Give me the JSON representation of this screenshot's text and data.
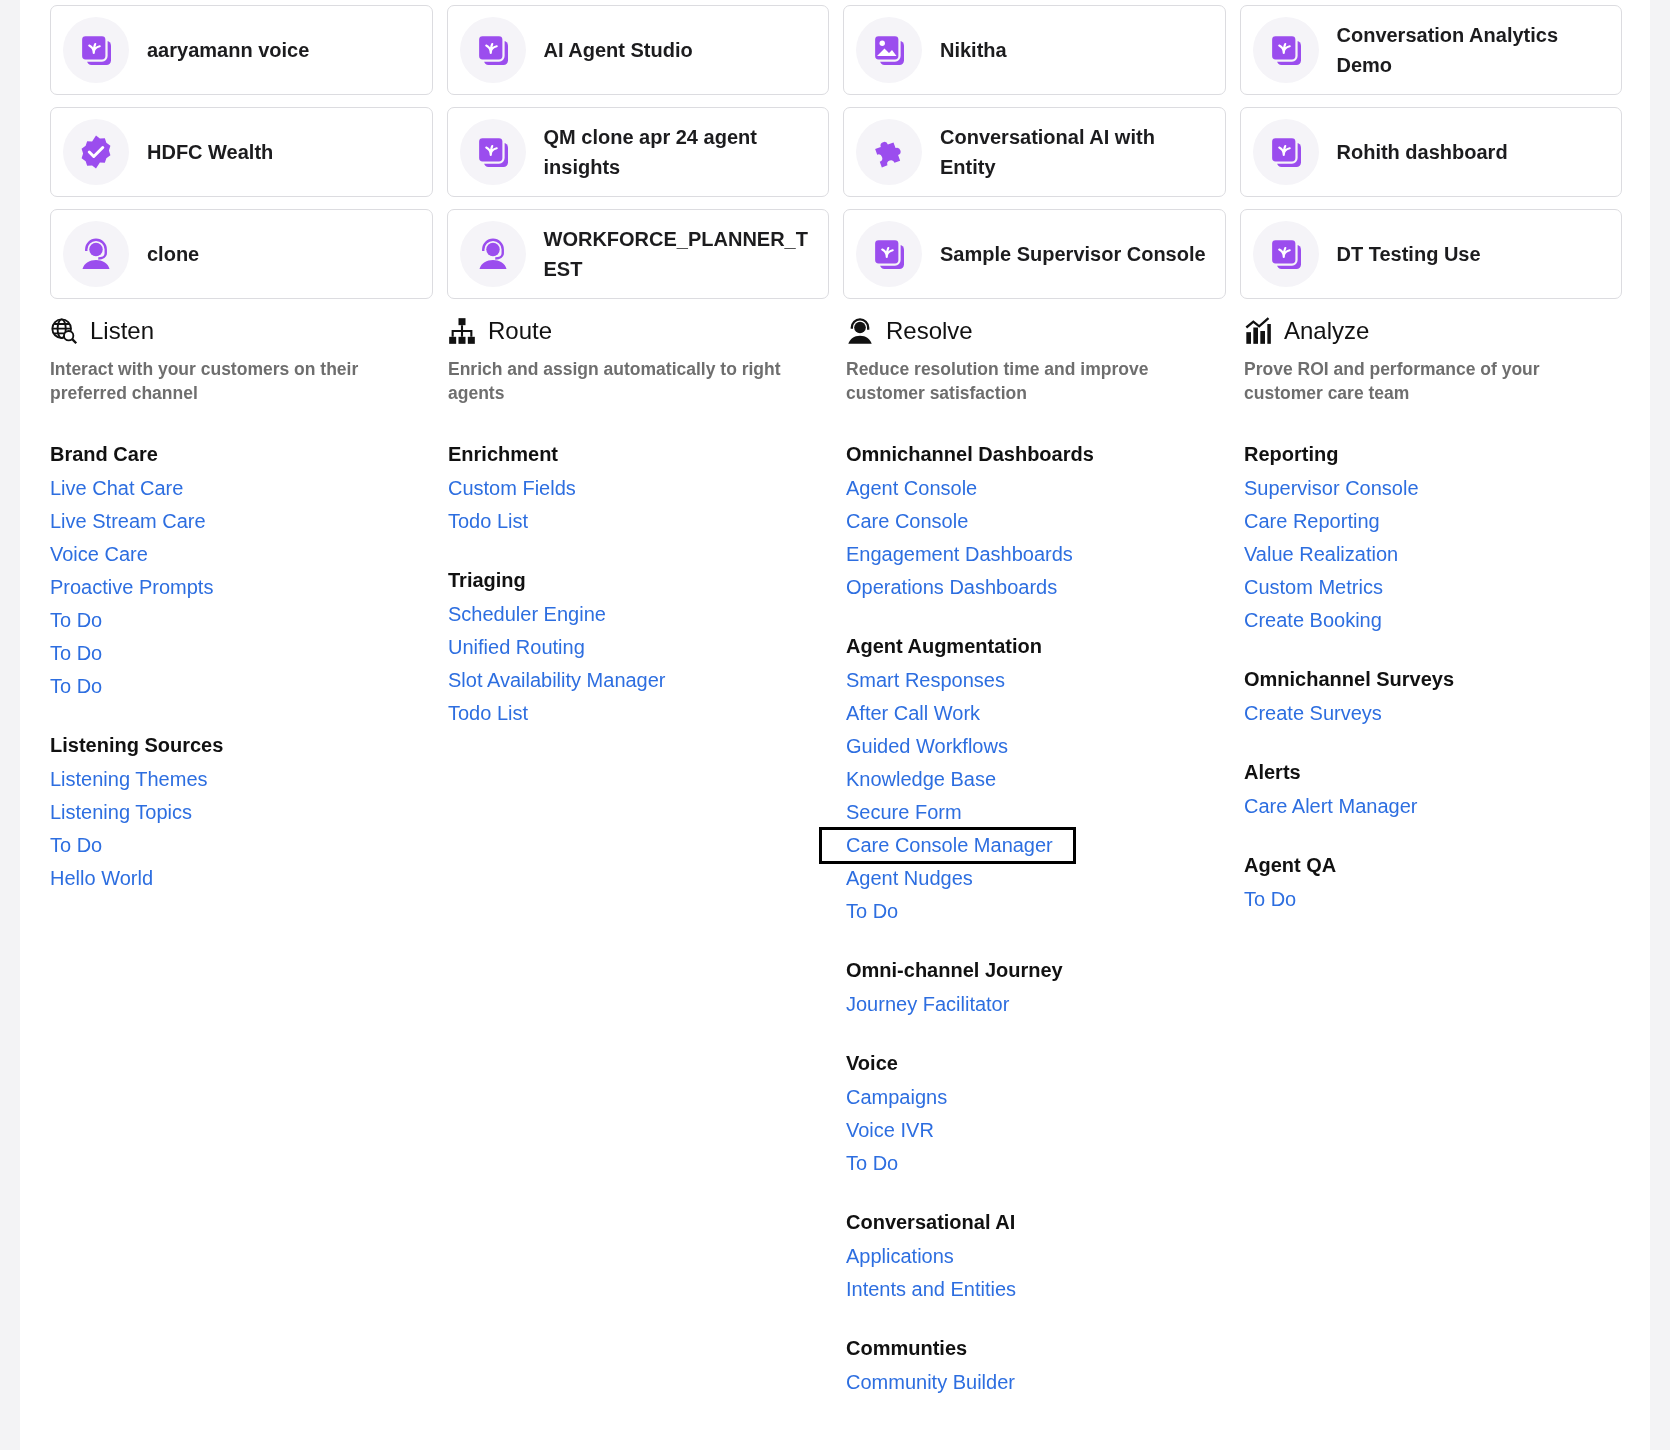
{
  "apps": [
    {
      "name": "aaryamann voice",
      "kind": "stack"
    },
    {
      "name": "AI Agent Studio",
      "kind": "stack"
    },
    {
      "name": "Nikitha",
      "kind": "image"
    },
    {
      "name": "Conversation Analytics Demo",
      "kind": "stack"
    },
    {
      "name": "HDFC Wealth",
      "kind": "badge"
    },
    {
      "name": "QM clone apr 24 agent insights",
      "kind": "stack"
    },
    {
      "name": "Conversational AI with Entity",
      "kind": "puzzle"
    },
    {
      "name": "Rohith dashboard",
      "kind": "stack"
    },
    {
      "name": "clone",
      "kind": "headset"
    },
    {
      "name": "WORKFORCE_PLANNER_TEST",
      "kind": "headset"
    },
    {
      "name": "Sample Supervisor Console",
      "kind": "stack"
    },
    {
      "name": "DT Testing Use",
      "kind": "stack"
    }
  ],
  "sections": [
    {
      "title": "Listen",
      "kind": "globe",
      "description": "Interact with your customers on their preferred channel",
      "groups": [
        {
          "title": "Brand Care",
          "links": [
            {
              "label": "Live Chat Care",
              "highlighted": false
            },
            {
              "label": "Live Stream Care",
              "highlighted": false
            },
            {
              "label": "Voice Care",
              "highlighted": false
            },
            {
              "label": "Proactive Prompts",
              "highlighted": false
            },
            {
              "label": "To Do",
              "highlighted": false
            },
            {
              "label": "To Do",
              "highlighted": false
            },
            {
              "label": "To Do",
              "highlighted": false
            }
          ]
        },
        {
          "title": "Listening Sources",
          "links": [
            {
              "label": "Listening Themes",
              "highlighted": false
            },
            {
              "label": "Listening Topics",
              "highlighted": false
            },
            {
              "label": "To Do",
              "highlighted": false
            },
            {
              "label": "Hello World",
              "highlighted": false
            }
          ]
        }
      ]
    },
    {
      "title": "Route",
      "kind": "hierarchy",
      "description": "Enrich and assign automatically to right agents",
      "groups": [
        {
          "title": "Enrichment",
          "links": [
            {
              "label": "Custom Fields",
              "highlighted": false
            },
            {
              "label": "Todo List",
              "highlighted": false
            }
          ]
        },
        {
          "title": "Triaging",
          "links": [
            {
              "label": "Scheduler Engine",
              "highlighted": false
            },
            {
              "label": "Unified Routing",
              "highlighted": false
            },
            {
              "label": "Slot Availability Manager",
              "highlighted": false
            },
            {
              "label": "Todo List",
              "highlighted": false
            }
          ]
        }
      ]
    },
    {
      "title": "Resolve",
      "kind": "agent",
      "description": "Reduce resolution time and improve customer satisfaction",
      "groups": [
        {
          "title": "Omnichannel Dashboards",
          "links": [
            {
              "label": "Agent Console",
              "highlighted": false
            },
            {
              "label": "Care Console",
              "highlighted": false
            },
            {
              "label": "Engagement Dashboards",
              "highlighted": false
            },
            {
              "label": "Operations Dashboards",
              "highlighted": false
            }
          ]
        },
        {
          "title": "Agent Augmentation",
          "links": [
            {
              "label": "Smart Responses",
              "highlighted": false
            },
            {
              "label": "After Call Work",
              "highlighted": false
            },
            {
              "label": "Guided Workflows",
              "highlighted": false
            },
            {
              "label": "Knowledge Base",
              "highlighted": false
            },
            {
              "label": "Secure Form",
              "highlighted": false
            },
            {
              "label": "Care Console Manager",
              "highlighted": true
            },
            {
              "label": "Agent Nudges",
              "highlighted": false
            },
            {
              "label": "To Do",
              "highlighted": false
            }
          ]
        },
        {
          "title": "Omni-channel Journey",
          "links": [
            {
              "label": "Journey Facilitator",
              "highlighted": false
            }
          ]
        },
        {
          "title": "Voice",
          "links": [
            {
              "label": "Campaigns",
              "highlighted": false
            },
            {
              "label": "Voice IVR",
              "highlighted": false
            },
            {
              "label": "To Do",
              "highlighted": false
            }
          ]
        },
        {
          "title": "Conversational AI",
          "links": [
            {
              "label": "Applications",
              "highlighted": false
            },
            {
              "label": "Intents and Entities",
              "highlighted": false
            }
          ]
        },
        {
          "title": "Communties",
          "links": [
            {
              "label": "Community Builder",
              "highlighted": false
            }
          ]
        }
      ]
    },
    {
      "title": "Analyze",
      "kind": "chart",
      "description": "Prove ROI and performance of your customer care team",
      "groups": [
        {
          "title": "Reporting",
          "links": [
            {
              "label": "Supervisor Console",
              "highlighted": false
            },
            {
              "label": "Care Reporting",
              "highlighted": false
            },
            {
              "label": "Value Realization",
              "highlighted": false
            },
            {
              "label": "Custom Metrics",
              "highlighted": false
            },
            {
              "label": "Create Booking",
              "highlighted": false
            }
          ]
        },
        {
          "title": "Omnichannel Surveys",
          "links": [
            {
              "label": "Create Surveys",
              "highlighted": false
            }
          ]
        },
        {
          "title": "Alerts",
          "links": [
            {
              "label": "Care Alert Manager",
              "highlighted": false
            }
          ]
        },
        {
          "title": "Agent QA",
          "links": [
            {
              "label": "To Do",
              "highlighted": false
            }
          ]
        }
      ]
    }
  ]
}
